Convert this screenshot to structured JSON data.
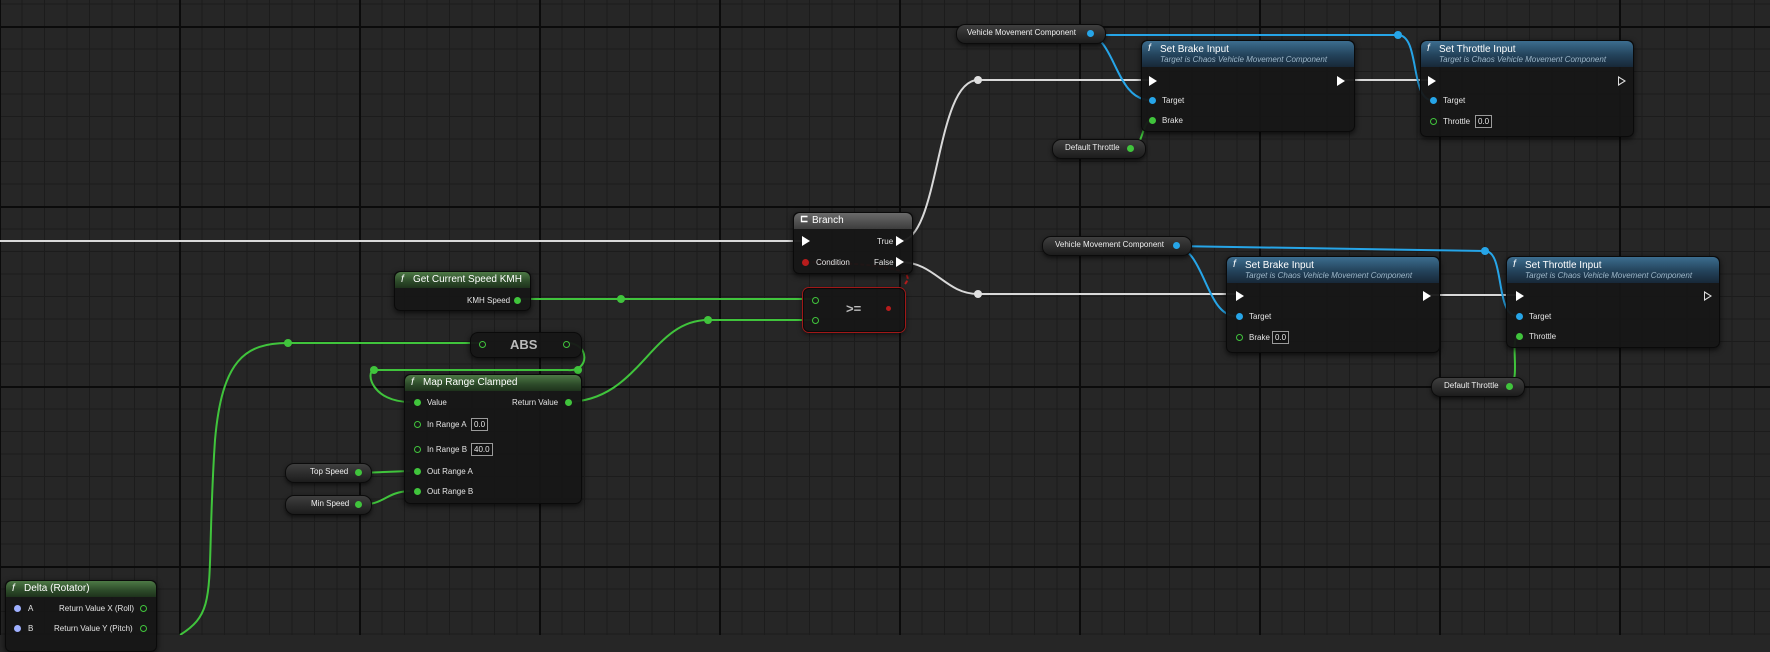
{
  "colors": {
    "exec": "#e5e5e5",
    "object": "#26a5e8",
    "float": "#40c43c",
    "bool": "#b71c1c",
    "func_header": "#23425a",
    "pure_header": "#2c4a29"
  },
  "nodes": {
    "vmc_top": {
      "label": "Vehicle Movement Component"
    },
    "set_brake_top": {
      "title": "Set Brake Input",
      "subtitle": "Target is Chaos Vehicle Movement Component",
      "pin_target": "Target",
      "pin_brake": "Brake"
    },
    "set_throttle_top": {
      "title": "Set Throttle Input",
      "subtitle": "Target is Chaos Vehicle Movement Component",
      "pin_target": "Target",
      "pin_throttle": "Throttle",
      "throttle_value": "0.0"
    },
    "default_throttle_top": {
      "label": "Default Throttle"
    },
    "branch": {
      "title": "Branch",
      "pin_true": "True",
      "pin_false": "False",
      "pin_condition": "Condition"
    },
    "vmc_bottom": {
      "label": "Vehicle Movement Component"
    },
    "set_brake_bottom": {
      "title": "Set Brake Input",
      "subtitle": "Target is Chaos Vehicle Movement Component",
      "pin_target": "Target",
      "pin_brake": "Brake",
      "brake_value": "0.0"
    },
    "set_throttle_bottom": {
      "title": "Set Throttle Input",
      "subtitle": "Target is Chaos Vehicle Movement Component",
      "pin_target": "Target",
      "pin_throttle": "Throttle"
    },
    "default_throttle_bottom": {
      "label": "Default Throttle"
    },
    "get_speed": {
      "title": "Get Current Speed KMH",
      "pin_out": "KMH Speed"
    },
    "compare": {
      "op": ">="
    },
    "abs": {
      "label": "ABS"
    },
    "map_range": {
      "title": "Map Range Clamped",
      "pin_value": "Value",
      "pin_return": "Return Value",
      "pin_in_a": "In Range A",
      "in_a_value": "0.0",
      "pin_in_b": "In Range B",
      "in_b_value": "40.0",
      "pin_out_a": "Out Range A",
      "pin_out_b": "Out Range B"
    },
    "top_speed": {
      "label": "Top Speed"
    },
    "min_speed": {
      "label": "Min Speed"
    },
    "delta_rotator": {
      "title": "Delta (Rotator)",
      "pin_a": "A",
      "pin_b": "B",
      "ret_x": "Return Value X (Roll)",
      "ret_y": "Return Value Y (Pitch)"
    }
  }
}
